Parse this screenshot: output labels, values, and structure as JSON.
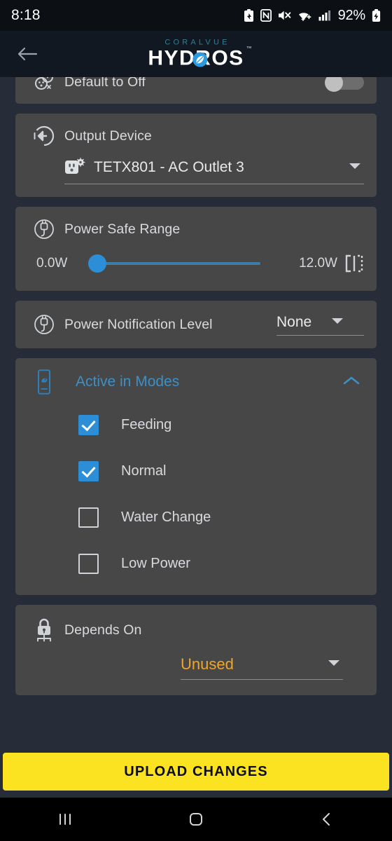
{
  "statusbar": {
    "time": "8:18",
    "battery_percent": "92%",
    "icons": [
      "battery-saver-icon",
      "nfc-icon",
      "mute-icon",
      "wifi-icon",
      "cellular-signal-icon",
      "charging-battery-icon"
    ]
  },
  "appbar": {
    "back_icon": "back-arrow-icon",
    "brand_top": "CORALVUE",
    "brand_main": "HYDROS",
    "brand_tm": "™"
  },
  "cards": {
    "default_to_off": {
      "icon": "outlet-power-off-icon",
      "label": "Default to Off",
      "toggle_state": "off"
    },
    "output_device": {
      "icon": "output-arrow-icon",
      "label": "Output Device",
      "value_icon": "ac-outlet-icon",
      "value": "TETX801 - AC Outlet 3",
      "caret_icon": "chevron-down-icon"
    },
    "power_safe_range": {
      "icon": "power-plug-icon",
      "label": "Power Safe Range",
      "min_value": "0.0W",
      "max_value": "12.0W",
      "thumb_percent": 0,
      "range_icon": "range-bracket-icon"
    },
    "power_notification_level": {
      "icon": "power-plug-icon",
      "label": "Power Notification Level",
      "value": "None",
      "caret_icon": "chevron-down-icon"
    },
    "active_in_modes": {
      "icon": "aquarium-mode-icon",
      "title": "Active in Modes",
      "chevron_icon": "chevron-up-icon",
      "items": [
        {
          "label": "Feeding",
          "checked": true
        },
        {
          "label": "Normal",
          "checked": true
        },
        {
          "label": "Water Change",
          "checked": false
        },
        {
          "label": "Low Power",
          "checked": false
        }
      ]
    },
    "depends_on": {
      "icon": "lock-icon",
      "label": "Depends On",
      "value": "Unused",
      "caret_icon": "chevron-down-icon"
    }
  },
  "upload": {
    "label": "UPLOAD CHANGES"
  },
  "navbar": {
    "recents_icon": "recents-icon",
    "home_icon": "home-icon",
    "back_icon": "nav-back-icon"
  },
  "colors": {
    "page_bg": "#262d38",
    "card_bg": "#474747",
    "accent_blue": "#2b8ed6",
    "link_blue": "#3d8fc6",
    "warning_orange": "#f0a52b",
    "upload_yellow": "#fbe322"
  }
}
